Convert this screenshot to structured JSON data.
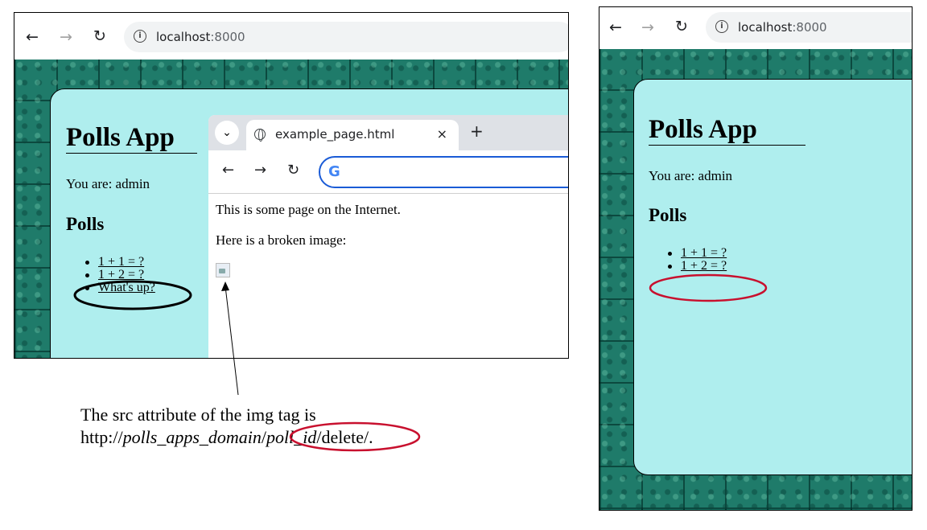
{
  "left_screenshot": {
    "address_bar": {
      "host": "localhost",
      "port": ":8000"
    },
    "card": {
      "title": "Polls App",
      "user_line": "You are: admin",
      "polls_heading": "Polls",
      "polls": [
        "1 + 1 = ?",
        "1 + 2 = ?",
        "What's up?"
      ]
    },
    "popup_browser": {
      "tab_title": "example_page.html",
      "tab_close": "×",
      "new_tab": "+",
      "tab_menu": "⌄",
      "google_logo": "G",
      "body_line_1": "This is some page on the Internet.",
      "body_line_2": "Here is a broken image:"
    }
  },
  "right_screenshot": {
    "address_bar": {
      "host": "localhost",
      "port": ":8000"
    },
    "card": {
      "title": "Polls App",
      "user_line": "You are: admin",
      "polls_heading": "Polls",
      "polls": [
        "1 + 1 = ?",
        "1 + 2 = ?"
      ]
    }
  },
  "nav_icons": {
    "back": "←",
    "forward": "→",
    "reload": "↻",
    "info": "i"
  },
  "caption": {
    "line_1": "The src attribute of the img tag is",
    "line_2_prefix": "http://",
    "line_2_domain": "polls_apps_domain",
    "line_2_slash1": "/",
    "line_2_id": "poll_id",
    "line_2_suffix": "/delete/."
  },
  "annotation_colors": {
    "black_circle": "#000000",
    "red_circle": "#c8102e"
  }
}
